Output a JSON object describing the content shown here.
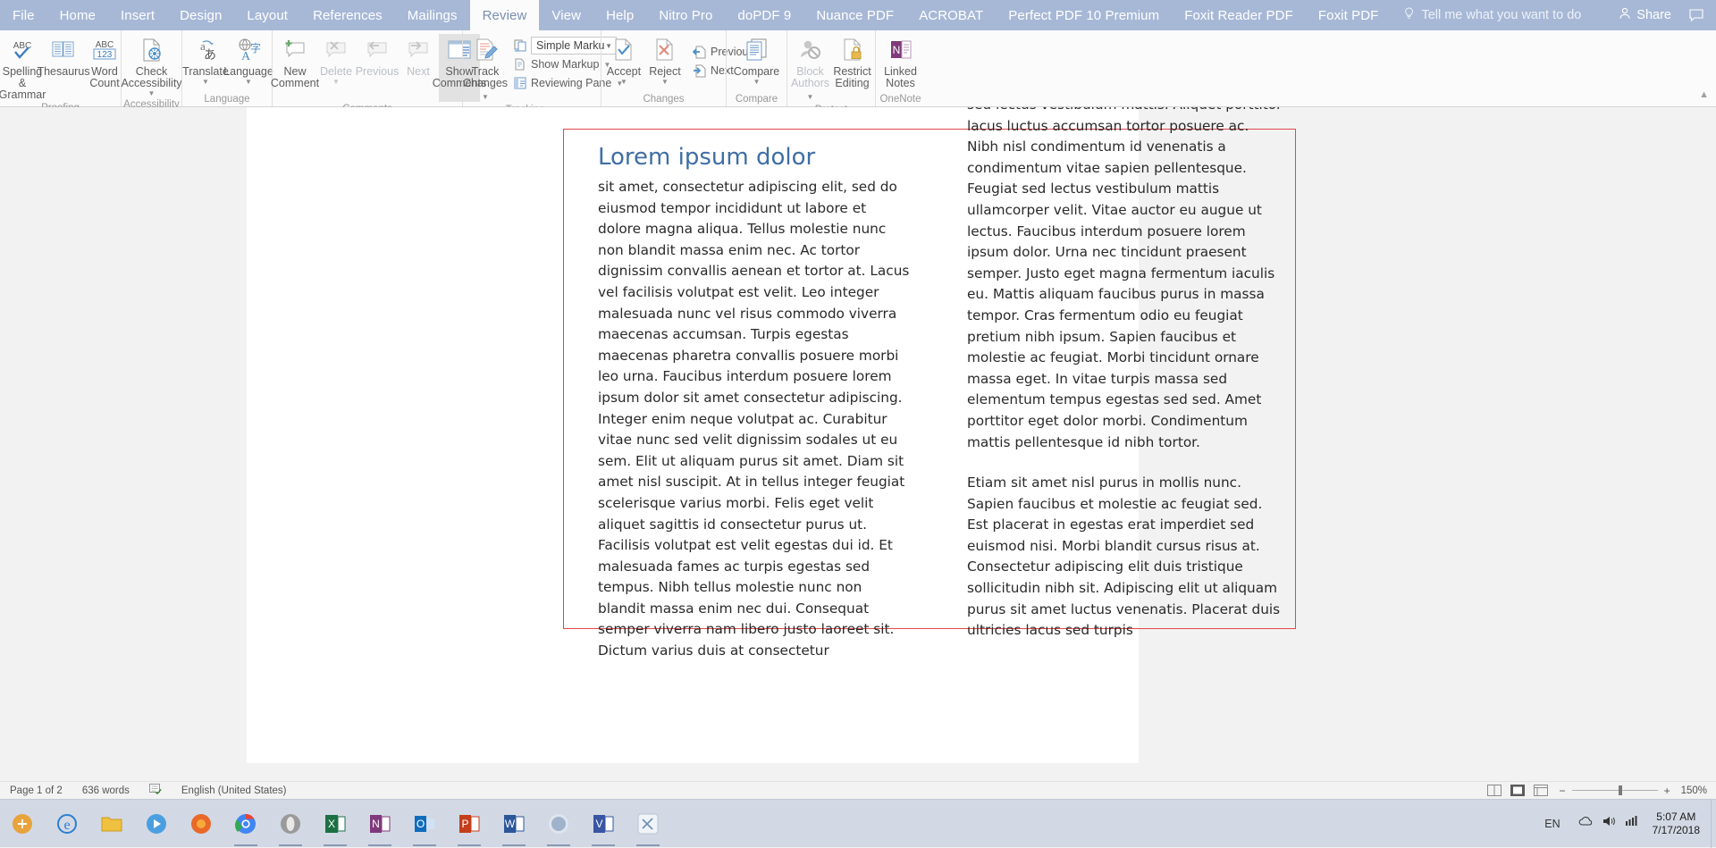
{
  "window": {
    "app": "Microsoft Word",
    "tabs": [
      {
        "label": "File",
        "active": false
      },
      {
        "label": "Home",
        "active": false
      },
      {
        "label": "Insert",
        "active": false
      },
      {
        "label": "Design",
        "active": false
      },
      {
        "label": "Layout",
        "active": false
      },
      {
        "label": "References",
        "active": false
      },
      {
        "label": "Mailings",
        "active": false
      },
      {
        "label": "Review",
        "active": true
      },
      {
        "label": "View",
        "active": false
      },
      {
        "label": "Help",
        "active": false
      },
      {
        "label": "Nitro Pro",
        "active": false
      },
      {
        "label": "doPDF 9",
        "active": false
      },
      {
        "label": "Nuance PDF",
        "active": false
      },
      {
        "label": "ACROBAT",
        "active": false
      },
      {
        "label": "Perfect PDF 10 Premium",
        "active": false
      },
      {
        "label": "Foxit Reader PDF",
        "active": false
      },
      {
        "label": "Foxit PDF",
        "active": false
      }
    ],
    "tell_me": "Tell me what you want to do",
    "share": "Share",
    "accent_tabbar": "#a7b8d6"
  },
  "ribbon": {
    "groups": [
      {
        "name": "proofing",
        "label": "Proofing",
        "buttons": [
          {
            "label": "Spelling &\nGrammar",
            "icon": "abc-check-icon",
            "disabled": false,
            "caret": false
          },
          {
            "label": "Thesaurus",
            "icon": "thesaurus-book-icon",
            "disabled": false,
            "caret": false
          },
          {
            "label": "Word\nCount",
            "icon": "abc-123-icon",
            "disabled": false,
            "caret": false
          }
        ]
      },
      {
        "name": "accessibility",
        "label": "Accessibility",
        "buttons": [
          {
            "label": "Check\nAccessibility",
            "icon": "check-accessibility-icon",
            "disabled": false,
            "caret": true
          }
        ]
      },
      {
        "name": "language",
        "label": "Language",
        "buttons": [
          {
            "label": "Translate",
            "icon": "translate-icon",
            "disabled": false,
            "caret": true
          },
          {
            "label": "Language",
            "icon": "language-globe-icon",
            "disabled": false,
            "caret": true
          }
        ]
      },
      {
        "name": "comments",
        "label": "Comments",
        "buttons": [
          {
            "label": "New\nComment",
            "icon": "new-comment-icon",
            "disabled": false,
            "caret": false
          },
          {
            "label": "Delete",
            "icon": "delete-comment-icon",
            "disabled": true,
            "caret": true
          },
          {
            "label": "Previous",
            "icon": "previous-comment-icon",
            "disabled": true,
            "caret": false
          },
          {
            "label": "Next",
            "icon": "next-comment-icon",
            "disabled": true,
            "caret": false
          },
          {
            "label": "Show\nComments",
            "icon": "show-comments-icon",
            "disabled": false,
            "caret": false,
            "toggled": true
          }
        ]
      },
      {
        "name": "tracking",
        "label": "Tracking",
        "has_dialog_launcher": true,
        "buttons": [
          {
            "label": "Track\nChanges",
            "icon": "track-changes-icon",
            "disabled": false,
            "caret": true,
            "inline_caret": true
          }
        ],
        "small_items": [
          {
            "label": "Simple Markup",
            "type": "combo",
            "icon": "display-for-review-icon"
          },
          {
            "label": "Show Markup",
            "type": "menu",
            "icon": "show-markup-icon"
          },
          {
            "label": "Reviewing Pane",
            "type": "menu",
            "icon": "reviewing-pane-icon"
          }
        ]
      },
      {
        "name": "changes",
        "label": "Changes",
        "buttons": [
          {
            "label": "Accept",
            "icon": "accept-change-icon",
            "disabled": false,
            "caret": true
          },
          {
            "label": "Reject",
            "icon": "reject-change-icon",
            "disabled": false,
            "caret": true
          }
        ],
        "small_items": [
          {
            "label": "Previous",
            "type": "button",
            "icon": "previous-change-icon"
          },
          {
            "label": "Next",
            "type": "button",
            "icon": "next-change-icon"
          }
        ]
      },
      {
        "name": "compare",
        "label": "Compare",
        "buttons": [
          {
            "label": "Compare",
            "icon": "compare-docs-icon",
            "disabled": false,
            "caret": true
          }
        ]
      },
      {
        "name": "protect",
        "label": "Protect",
        "buttons": [
          {
            "label": "Block\nAuthors",
            "icon": "block-authors-icon",
            "disabled": true,
            "caret": true,
            "inline_caret": true
          },
          {
            "label": "Restrict\nEditing",
            "icon": "restrict-editing-icon",
            "disabled": false,
            "caret": false
          }
        ]
      },
      {
        "name": "onenote",
        "label": "OneNote",
        "buttons": [
          {
            "label": "Linked\nNotes",
            "icon": "onenote-linked-notes-icon",
            "disabled": false,
            "caret": false
          }
        ]
      }
    ]
  },
  "document": {
    "heading": "Lorem ipsum dolor",
    "annotation_color": "#e2484e",
    "left_column": [
      "sit amet, consectetur adipiscing elit, sed do eiusmod tempor incididunt ut labore et dolore magna aliqua. Tellus molestie nunc non blandit massa enim nec. Ac tortor dignissim convallis aenean et tortor at. Lacus vel facilisis volutpat est velit. Leo integer malesuada nunc vel risus commodo viverra maecenas accumsan. Turpis egestas maecenas pharetra convallis posuere morbi leo urna. Faucibus interdum posuere lorem ipsum dolor sit amet consectetur adipiscing. Integer enim neque volutpat ac. Curabitur vitae nunc sed velit dignissim sodales ut eu sem. Elit ut aliquam purus sit amet. Diam sit amet nisl suscipit. At in tellus integer feugiat scelerisque varius morbi. Felis eget velit aliquet sagittis id consectetur purus ut. Facilisis volutpat est velit egestas dui id. Et malesuada fames ac turpis egestas sed tempus. Nibh tellus molestie nunc non blandit massa enim nec dui. Consequat semper viverra nam libero justo laoreet sit. Dictum varius duis at consectetur"
    ],
    "right_column": [
      "sed lectus vestibulum mattis. Aliquet porttitor lacus luctus accumsan tortor posuere ac. Nibh nisl condimentum id venenatis a condimentum vitae sapien pellentesque. Feugiat sed lectus vestibulum mattis ullamcorper velit. Vitae auctor eu augue ut lectus. Faucibus interdum posuere lorem ipsum dolor. Urna nec tincidunt praesent semper. Justo eget magna fermentum iaculis eu. Mattis aliquam faucibus purus in massa tempor. Cras fermentum odio eu feugiat pretium nibh ipsum. Sapien faucibus et molestie ac feugiat. Morbi tincidunt ornare massa eget. In vitae turpis massa sed elementum tempus egestas sed sed. Amet porttitor eget dolor morbi. Condimentum mattis pellentesque id nibh tortor.",
      "Etiam sit amet nisl purus in mollis nunc. Sapien faucibus et molestie ac feugiat sed. Est placerat in egestas erat imperdiet sed euismod nisi. Morbi blandit cursus risus at. Consectetur adipiscing elit duis tristique sollicitudin nibh sit. Adipiscing elit ut aliquam purus sit amet luctus venenatis. Placerat duis ultricies lacus sed turpis"
    ]
  },
  "status_bar": {
    "page": "Page 1 of 2",
    "words": "636 words",
    "proofing_icon": "spelling-check-icon",
    "language": "English (United States)",
    "views": [
      "read-mode-icon",
      "print-layout-icon",
      "web-layout-icon"
    ],
    "zoom_out": "−",
    "zoom_in": "+",
    "zoom_level": "150%"
  },
  "taskbar": {
    "items": [
      {
        "name": "start-button",
        "glyph": "⊞",
        "color": "#e8a33d",
        "running": false
      },
      {
        "name": "internet-explorer-icon",
        "glyph": "e",
        "color": "#2a7fd4",
        "running": false
      },
      {
        "name": "file-explorer-icon",
        "glyph": "🗀",
        "color": "#f0c040",
        "running": false
      },
      {
        "name": "media-player-icon",
        "glyph": "▶",
        "color": "#4b9fe0",
        "running": false
      },
      {
        "name": "firefox-icon",
        "glyph": "●",
        "color": "#e8692a",
        "running": false
      },
      {
        "name": "chrome-icon",
        "glyph": "◉",
        "color": "#4285f4",
        "running": true
      },
      {
        "name": "opera-icon",
        "glyph": "O",
        "color": "#8a8a8a",
        "running": true
      },
      {
        "name": "excel-icon",
        "glyph": "X",
        "color": "#1d7044",
        "running": true
      },
      {
        "name": "onenote-icon",
        "glyph": "N",
        "color": "#80397b",
        "running": true
      },
      {
        "name": "outlook-icon",
        "glyph": "O",
        "color": "#0f6cbd",
        "running": true
      },
      {
        "name": "powerpoint-icon",
        "glyph": "P",
        "color": "#c43e1c",
        "running": true
      },
      {
        "name": "word-icon",
        "glyph": "W",
        "color": "#2b579a",
        "running": true
      },
      {
        "name": "skype-icon",
        "glyph": "S",
        "color": "#00aff0",
        "running": true
      },
      {
        "name": "visio-icon",
        "glyph": "V",
        "color": "#3955a3",
        "running": true
      },
      {
        "name": "snipping-tool-icon",
        "glyph": "✂",
        "color": "#6b8fb5",
        "running": true
      }
    ],
    "language": "EN",
    "time": "5:07 AM",
    "date": "7/17/2018"
  }
}
